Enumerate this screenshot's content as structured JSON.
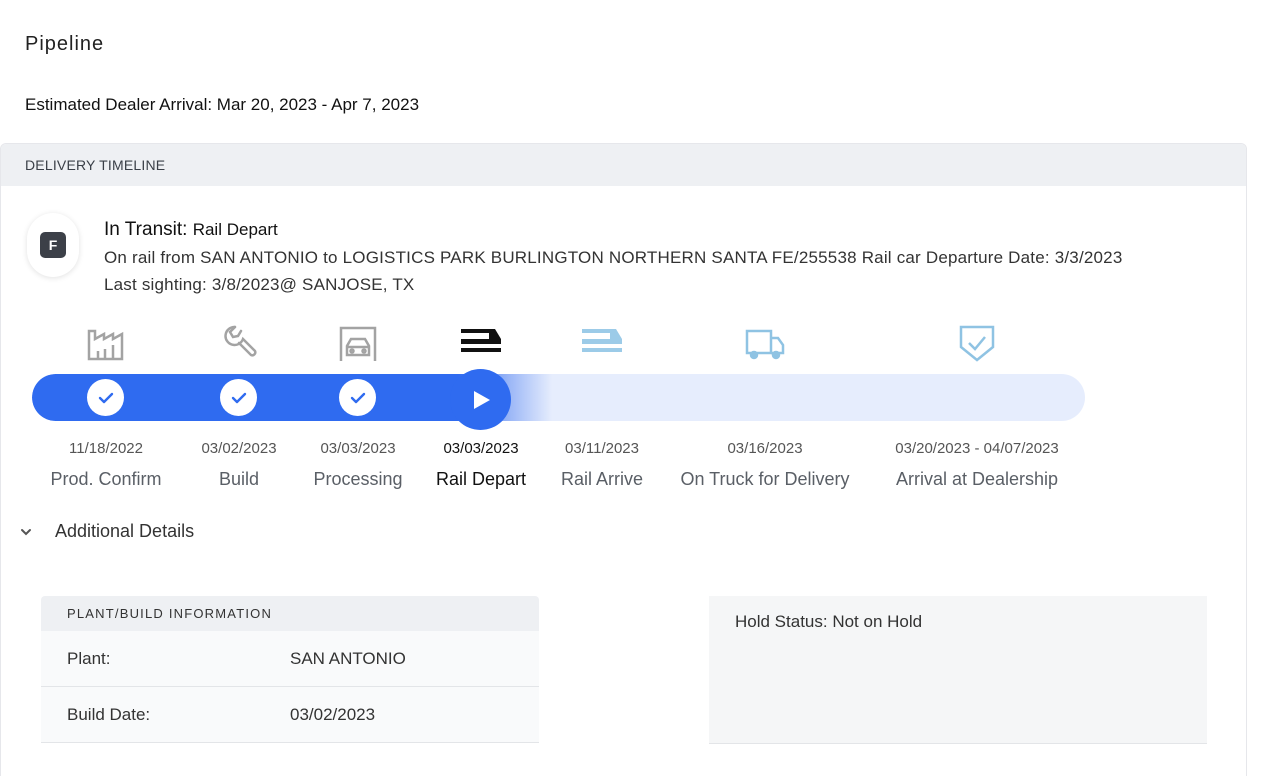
{
  "page": {
    "title": "Pipeline",
    "eta": "Estimated Dealer Arrival: Mar 20, 2023 - Apr 7, 2023"
  },
  "timeline": {
    "header": "DELIVERY TIMELINE",
    "badge_letter": "F",
    "status_label": "In Transit:",
    "status_value": "Rail Depart",
    "description": "On rail from SAN ANTONIO to LOGISTICS PARK BURLINGTON NORTHERN SANTA FE/255538 Rail car Departure Date: 3/3/2023",
    "last_sighting": "Last sighting: 3/8/2023@ SANJOSE, TX",
    "progress_completed_steps": 4,
    "steps": [
      {
        "date": "11/18/2022",
        "label": "Prod. Confirm",
        "icon": "factory-icon",
        "state": "complete"
      },
      {
        "date": "03/02/2023",
        "label": "Build",
        "icon": "wrench-icon",
        "state": "complete"
      },
      {
        "date": "03/03/2023",
        "label": "Processing",
        "icon": "car-icon",
        "state": "complete"
      },
      {
        "date": "03/03/2023",
        "label": "Rail Depart",
        "icon": "rail-icon",
        "state": "current"
      },
      {
        "date": "03/11/2023",
        "label": "Rail Arrive",
        "icon": "rail-icon",
        "state": "pending"
      },
      {
        "date": "03/16/2023",
        "label": "On Truck for Delivery",
        "icon": "truck-icon",
        "state": "pending"
      },
      {
        "date": "03/20/2023 - 04/07/2023",
        "label": "Arrival at Dealership",
        "icon": "shield-check-icon",
        "state": "pending"
      }
    ]
  },
  "details": {
    "toggle_label": "Additional Details",
    "plant": {
      "header": "PLANT/BUILD INFORMATION",
      "rows": [
        {
          "key": "Plant:",
          "value": "SAN ANTONIO"
        },
        {
          "key": "Build Date:",
          "value": "03/02/2023"
        }
      ]
    },
    "hold_status": "Hold Status: Not on Hold"
  },
  "colors": {
    "accent": "#2f6bf0",
    "track_bg": "#e6edfd",
    "done_icon": "#9a9a9a",
    "pending_icon": "#8fc3e3"
  }
}
